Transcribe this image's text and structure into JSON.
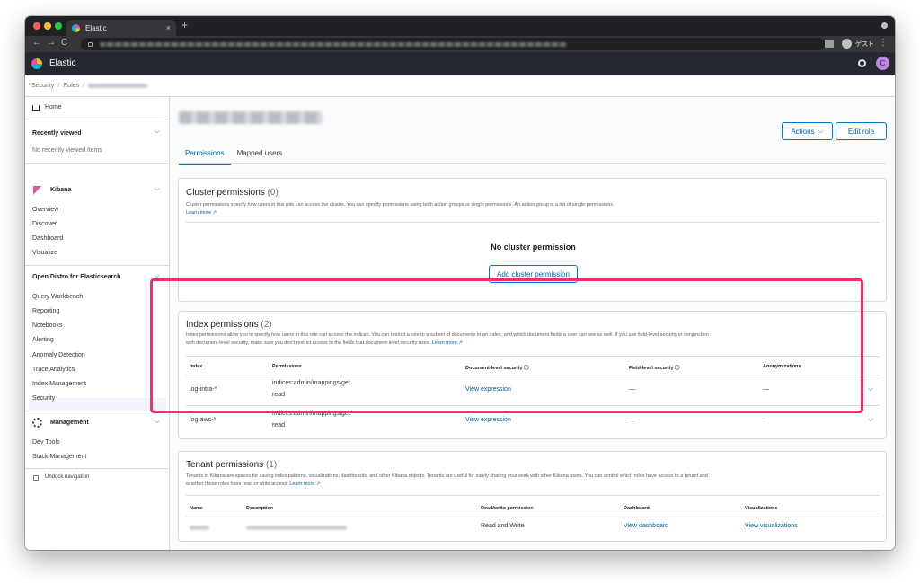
{
  "browser": {
    "tab_title": "Elastic",
    "close_glyph": "×",
    "new_tab_glyph": "+",
    "back_glyph": "←",
    "forward_glyph": "→",
    "reload_glyph": "C",
    "profile_label": "ゲスト",
    "menu_glyph": "⋮"
  },
  "header": {
    "app_title": "Elastic",
    "avatar_initial": "C"
  },
  "breadcrumb": {
    "items": [
      "Security",
      "Roles"
    ],
    "separator": "/"
  },
  "sidebar": {
    "home": "Home",
    "recently_viewed": {
      "title": "Recently viewed",
      "empty": "No recently viewed items"
    },
    "kibana": {
      "title": "Kibana",
      "items": [
        "Overview",
        "Discover",
        "Dashboard",
        "Visualize"
      ]
    },
    "open_distro": {
      "title": "Open Distro for Elasticsearch",
      "items": [
        "Query Workbench",
        "Reporting",
        "Notebooks",
        "Alerting",
        "Anomaly Detection",
        "Trace Analytics",
        "Index Management",
        "Security"
      ]
    },
    "management": {
      "title": "Management",
      "items": [
        "Dev Tools",
        "Stack Management"
      ]
    },
    "undock": "Undock navigation",
    "chevron_glyph": "⌵"
  },
  "main": {
    "actions_label": "Actions",
    "actions_chevron": "⌵",
    "edit_role_label": "Edit role",
    "tabs": [
      {
        "label": "Permissions",
        "active": true
      },
      {
        "label": "Mapped users",
        "active": false
      }
    ]
  },
  "cluster_permissions": {
    "title": "Cluster permissions",
    "count": "(0)",
    "description": "Cluster permissions specify how users in this role can access the cluster. You can specify permissions using both action groups or single permissions. An action group is a list of single permissions.",
    "learn_more": "Learn more ↗",
    "empty_title": "No cluster permission",
    "add_button": "Add cluster permission"
  },
  "index_permissions": {
    "title": "Index permissions",
    "count": "(2)",
    "description": "Index permissions allow you to specify how users in this role can access the indices. You can restrict a role to a subset of documents in an index, and which document fields a user can see as well. If you use field-level security in conjunction with document-level security, make sure you don't restrict access to the fields that document-level security uses.",
    "learn_more": "Learn more ↗",
    "columns": [
      "Index",
      "Permissions",
      "Document-level security ⓘ",
      "Field-level security ⓘ",
      "Anonymizations"
    ],
    "rows": [
      {
        "index": "log-intra-*",
        "permissions": [
          "indices:admin/mappings/get",
          "read"
        ],
        "dls": "View expression",
        "fls": "—",
        "anonymizations": "—",
        "expand": "⌵"
      },
      {
        "index": "log-aws-*",
        "permissions": [
          "indices:admin/mappings/get",
          "read"
        ],
        "dls": "View expression",
        "fls": "—",
        "anonymizations": "—",
        "expand": "⌵"
      }
    ]
  },
  "tenant_permissions": {
    "title": "Tenant permissions",
    "count": "(1)",
    "description": "Tenants in Kibana are spaces for saving index patterns, visualizations, dashboards, and other Kibana objects. Tenants are useful for safely sharing your work with other Kibana users. You can control which roles have access to a tenant and whether those roles have read or write access.",
    "learn_more": "Learn more ↗",
    "columns": [
      "Name",
      "Description",
      "Read/write permission",
      "Dashboard",
      "Visualizations"
    ],
    "rows": [
      {
        "permission": "Read and Write",
        "dashboard": "View dashboard",
        "visualizations": "View visualizations"
      }
    ]
  }
}
